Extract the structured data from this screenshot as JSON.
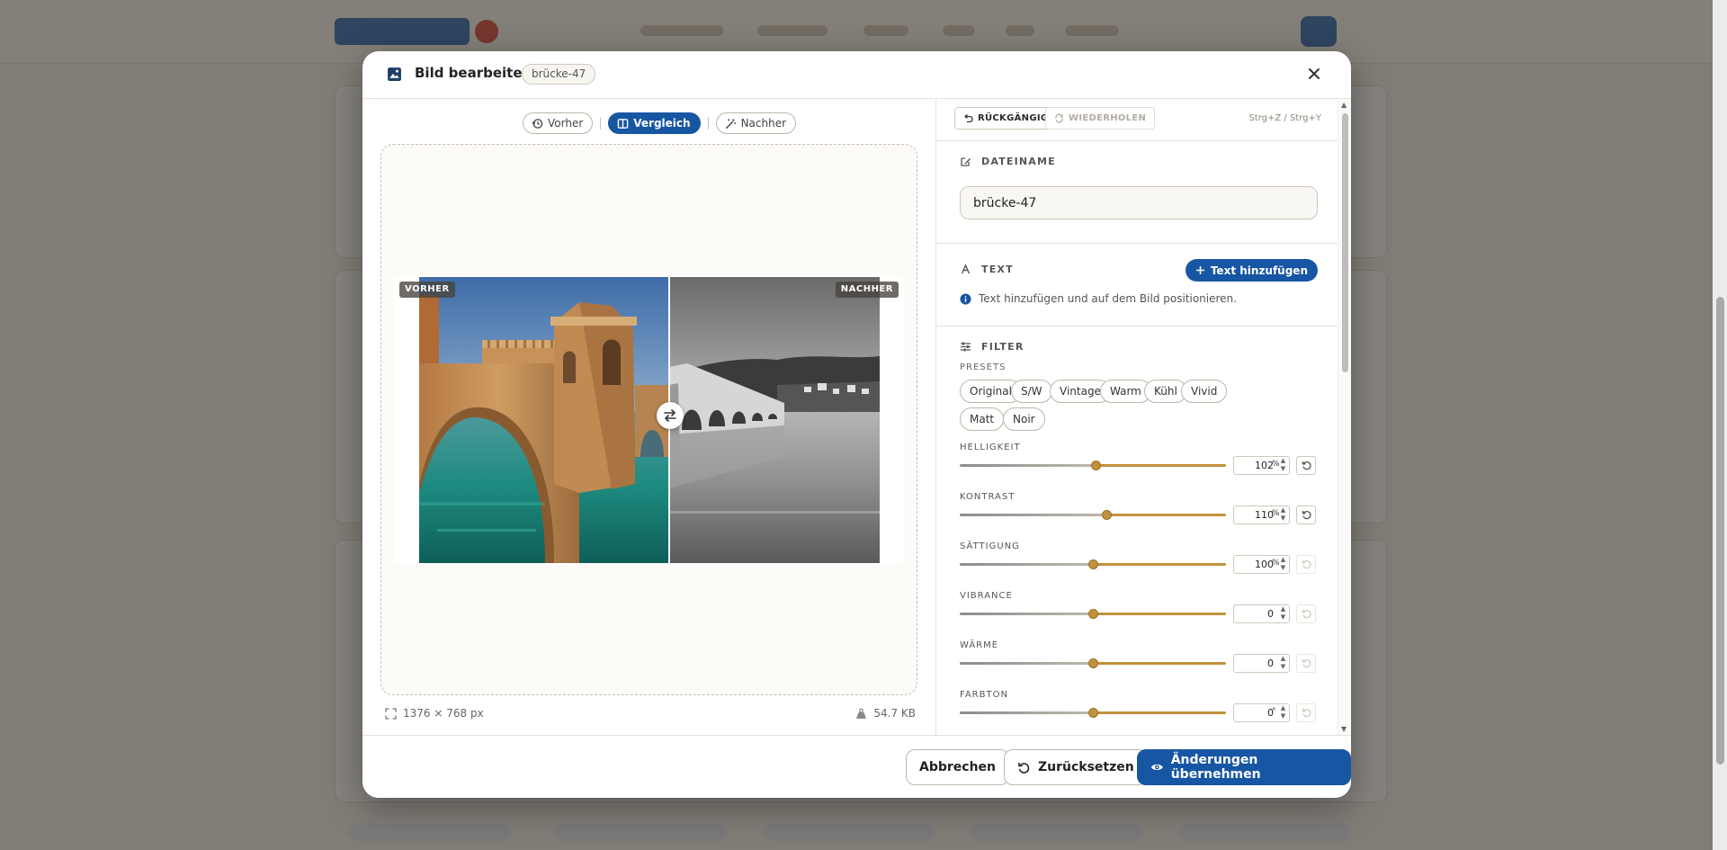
{
  "modal": {
    "title": "Bild bearbeiten",
    "tag": "brücke-47"
  },
  "view_toggle": {
    "before": "Vorher",
    "compare": "Vergleich",
    "after": "Nachher",
    "active": "compare"
  },
  "preview": {
    "before_label": "VORHER",
    "after_label": "NACHHER",
    "dimensions": "1376 × 768 px",
    "filesize": "54.7 KB"
  },
  "history": {
    "undo_label": "RÜCKGÄNGIG",
    "redo_label": "WIEDERHOLEN",
    "shortcut_hint": "Strg+Z / Strg+Y"
  },
  "filename_section": {
    "title": "DATEINAME",
    "value": "brücke-47"
  },
  "text_section": {
    "title": "TEXT",
    "add_button": "Text hinzufügen",
    "hint": "Text hinzufügen und auf dem Bild positionieren."
  },
  "filter_section": {
    "title": "FILTER",
    "presets_label": "PRESETS",
    "presets": [
      "Original",
      "S/W",
      "Vintage",
      "Warm",
      "Kühl",
      "Vivid",
      "Matt",
      "Noir"
    ],
    "sliders": [
      {
        "label": "HELLIGKEIT",
        "value": "102",
        "unit": "%",
        "level": 0.51,
        "reset_enabled": true
      },
      {
        "label": "KONTRAST",
        "value": "110",
        "unit": "%",
        "level": 0.55,
        "reset_enabled": true
      },
      {
        "label": "SÄTTIGUNG",
        "value": "100",
        "unit": "%",
        "level": 0.5,
        "reset_enabled": false
      },
      {
        "label": "VIBRANCE",
        "value": "0",
        "unit": "",
        "level": 0.5,
        "reset_enabled": false
      },
      {
        "label": "WÄRME",
        "value": "0",
        "unit": "",
        "level": 0.5,
        "reset_enabled": false
      },
      {
        "label": "FARBTON",
        "value": "0",
        "unit": "°",
        "level": 0.5,
        "reset_enabled": false
      }
    ]
  },
  "footer": {
    "cancel": "Abbrechen",
    "reset": "Zurücksetzen",
    "apply": "Änderungen übernehmen"
  },
  "colors": {
    "primary": "#1756a3",
    "slider_accent": "#c1913d"
  }
}
